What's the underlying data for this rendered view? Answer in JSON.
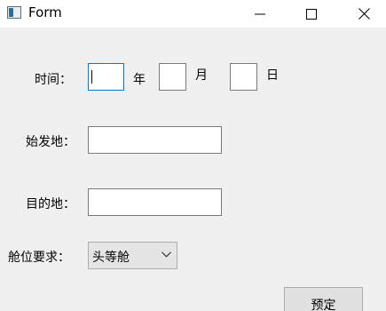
{
  "window": {
    "title": "Form",
    "minimize_icon": "minimize-icon",
    "maximize_icon": "maximize-icon",
    "close_icon": "close-icon"
  },
  "form": {
    "time_label": "时间：",
    "year_value": "",
    "year_unit": "年",
    "month_value": "",
    "month_unit": "月",
    "day_value": "",
    "day_unit": "日",
    "origin_label": "始发地：",
    "origin_value": "",
    "destination_label": "目的地：",
    "destination_value": "",
    "cabin_label": "舱位要求：",
    "cabin_selected": "头等舱",
    "book_button": "预定"
  }
}
